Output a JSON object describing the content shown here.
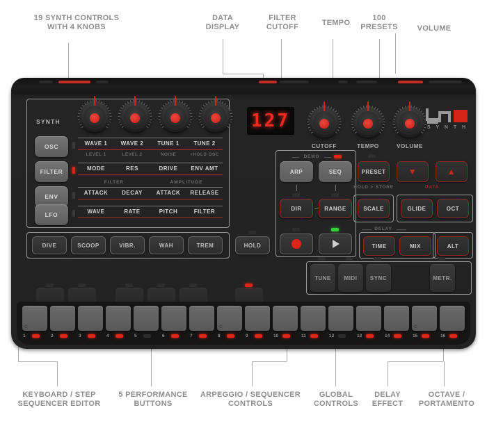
{
  "product": {
    "brand": "UNO",
    "line": "S Y N T H"
  },
  "annotations": {
    "top": [
      {
        "id": "synth-controls",
        "text": "19 SYNTH CONTROLS\nWITH 4 KNOBS"
      },
      {
        "id": "data-display",
        "text": "DATA\nDISPLAY"
      },
      {
        "id": "filter-cutoff",
        "text": "FILTER\nCUTOFF"
      },
      {
        "id": "tempo",
        "text": "TEMPO"
      },
      {
        "id": "presets",
        "text": "100\nPRESETS"
      },
      {
        "id": "volume",
        "text": "VOLUME"
      }
    ],
    "bottom": [
      {
        "id": "keyboard-step-sequencer",
        "text": "KEYBOARD / STEP\nSEQUENCER EDITOR"
      },
      {
        "id": "performance-buttons",
        "text": "5 PERFORMANCE\nBUTTONS"
      },
      {
        "id": "arp-seq-controls",
        "text": "ARPEGGIO / SEQUENCER\nCONTROLS"
      },
      {
        "id": "global-controls",
        "text": "GLOBAL\nCONTROLS"
      },
      {
        "id": "delay-effect",
        "text": "DELAY\nEFFECT"
      },
      {
        "id": "octave-portamento",
        "text": "OCTAVE /\nPORTAMENTO"
      }
    ]
  },
  "display": {
    "value": "127"
  },
  "knobs": [
    {
      "name": "knob-1",
      "label": ""
    },
    {
      "name": "knob-2",
      "label": ""
    },
    {
      "name": "knob-3",
      "label": ""
    },
    {
      "name": "knob-4",
      "label": ""
    },
    {
      "name": "cutoff",
      "label": "CUTOFF"
    },
    {
      "name": "tempo",
      "label": "TEMPO"
    },
    {
      "name": "volume",
      "label": "VOLUME"
    }
  ],
  "synth_section": {
    "title": "SYNTH",
    "rows": [
      {
        "button": "OSC",
        "params": [
          "WAVE 1",
          "WAVE 2",
          "TUNE 1",
          "TUNE 2"
        ],
        "sub": [
          "LEVEL 1",
          "LEVEL 2",
          "NOISE",
          "+HOLD OSC"
        ],
        "led": false,
        "sections": []
      },
      {
        "button": "FILTER",
        "params": [
          "MODE",
          "RES",
          "DRIVE",
          "ENV AMT"
        ],
        "sub": [],
        "led": true,
        "sections": []
      },
      {
        "button": "ENV",
        "params": [
          "ATTACK",
          "DECAY",
          "ATTACK",
          "RELEASE"
        ],
        "sub": [],
        "led": false,
        "sections": [
          "FILTER",
          "AMPLITUDE"
        ]
      },
      {
        "button": "LFO",
        "params": [
          "WAVE",
          "RATE",
          "PITCH",
          "FILTER"
        ],
        "sub": [],
        "led": false,
        "sections": []
      }
    ]
  },
  "performance_buttons": [
    "DIVE",
    "SCOOP",
    "VIBR.",
    "WAH",
    "TREM"
  ],
  "hold_button": "HOLD",
  "sequencer": {
    "demo_label": "DEMO",
    "arp": "ARP",
    "seq": "SEQ",
    "dir": "DIR",
    "range": "RANGE",
    "record": "record-button",
    "play": "play-button"
  },
  "global": {
    "preset": "PRESET",
    "preset_sub": "HOLD > STORE",
    "data_label": "DATA",
    "data_down": "▼",
    "data_up": "▲",
    "scale": "SCALE",
    "pads": [
      "TUNE",
      "MIDI",
      "SYNC"
    ]
  },
  "octave": {
    "glide": "GLIDE",
    "oct": "OCT"
  },
  "delay": {
    "title": "DELAY",
    "time": "TIME",
    "mix": "MIX"
  },
  "alt": {
    "button": "ALT",
    "metr": "METR."
  },
  "keyboard": {
    "keys": [
      {
        "num": "1",
        "c": "C",
        "led": true
      },
      {
        "num": "2",
        "c": "",
        "led": true
      },
      {
        "num": "3",
        "c": "",
        "led": true
      },
      {
        "num": "4",
        "c": "",
        "led": true
      },
      {
        "num": "5",
        "c": "",
        "led": false
      },
      {
        "num": "6",
        "c": "",
        "led": true
      },
      {
        "num": "7",
        "c": "",
        "led": true
      },
      {
        "num": "8",
        "c": "C",
        "led": true
      },
      {
        "num": "9",
        "c": "",
        "led": true
      },
      {
        "num": "10",
        "c": "",
        "led": true
      },
      {
        "num": "11",
        "c": "",
        "led": true
      },
      {
        "num": "12",
        "c": "",
        "led": false
      },
      {
        "num": "13",
        "c": "",
        "led": true
      },
      {
        "num": "14",
        "c": "",
        "led": true
      },
      {
        "num": "15",
        "c": "C",
        "led": true
      },
      {
        "num": "16",
        "c": "",
        "led": true
      }
    ]
  },
  "colors": {
    "accent_red": "#d6241a",
    "panel": "#222222",
    "callout_text": "#8e8e8e",
    "leader": "#aaaaaa"
  }
}
